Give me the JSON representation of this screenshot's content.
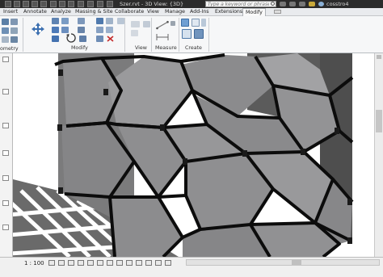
{
  "window": {
    "title": "Szer.rvt - 3D View: {3D}",
    "search_placeholder": "Type a keyword or phrase",
    "user": "cosstro4"
  },
  "tabs": [
    {
      "label": "Insert"
    },
    {
      "label": "Annotate"
    },
    {
      "label": "Analyze"
    },
    {
      "label": "Massing & Site"
    },
    {
      "label": "Collaborate"
    },
    {
      "label": "View"
    },
    {
      "label": "Manage"
    },
    {
      "label": "Add-Ins"
    },
    {
      "label": "Extensions"
    },
    {
      "label": "Modify",
      "active": true
    }
  ],
  "ribbon": {
    "geometry_label": "ometry",
    "panels": {
      "modify": "Modify",
      "view": "View",
      "measure": "Measure",
      "create": "Create"
    }
  },
  "status": {
    "scale": "1 : 100"
  },
  "icons": [
    "search-icon",
    "user-icon",
    "align-icon",
    "offset-icon",
    "mirror-icon",
    "move-icon",
    "copy-icon",
    "rotate-icon",
    "trim-icon",
    "split-icon",
    "array-icon",
    "scale-icon",
    "pin-icon",
    "delete-icon",
    "override-graphics-icon",
    "hide-icon",
    "measure-icon",
    "dimension-icon",
    "create-assembly-icon",
    "create-parts-icon",
    "create-group-icon"
  ],
  "colors": {
    "title_bar": "#2b2b2b",
    "ribbon_bg": "#f6f7f8",
    "glass_panel": "#8e8e90",
    "mullion": "#0c0c0c",
    "wall": "#646464",
    "active_tab_border": "#aeb2b7"
  }
}
